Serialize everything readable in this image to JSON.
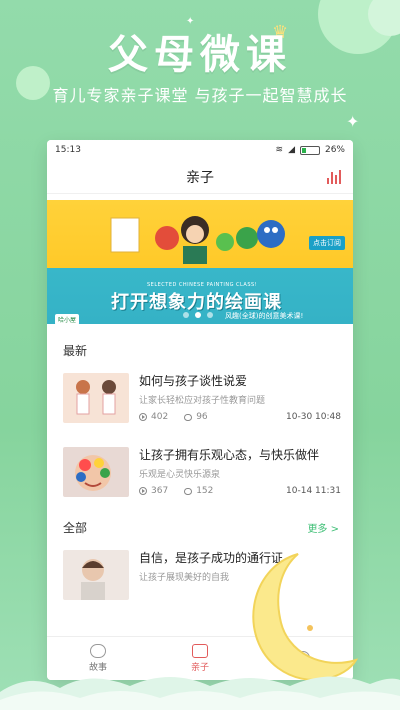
{
  "hero": {
    "title": "父母微课",
    "subtitle": "育儿专家亲子课堂  与孩子一起智慧成长"
  },
  "colors": {
    "background": "#8fd8a5",
    "accent_red": "#e25b5b",
    "accent_green": "#3fbf76",
    "banner_yellow": "#ffc928",
    "banner_teal": "#35b2c6"
  },
  "status_bar": {
    "time": "15:13",
    "battery": "26%",
    "battery_level": 0.26
  },
  "header": {
    "title": "亲子",
    "chart_icon": "bar-chart-icon"
  },
  "banner": {
    "tag": "点击订阅",
    "english": "SELECTED CHINESE PAINTING CLASS!",
    "headline": "打开想象力的绘画课",
    "caption": "风趣(全球)的创意美术课!",
    "logo": "哈小屋",
    "active_slide": 2,
    "slide_count": 3
  },
  "latest": {
    "title": "最新",
    "items": [
      {
        "title": "如何与孩子谈性说爱",
        "desc": "让家长轻松应对孩子性教育问题",
        "plays": "402",
        "comments": "96",
        "date": "10-30 10:48"
      },
      {
        "title": "让孩子拥有乐观心态，与快乐做伴",
        "desc": "乐观是心灵快乐源泉",
        "plays": "367",
        "comments": "152",
        "date": "10-14 11:31"
      }
    ]
  },
  "all": {
    "title": "全部",
    "more": "更多 >",
    "items": [
      {
        "title": "自信，是孩子成功的通行证",
        "desc": "让孩子展现美好的自我"
      }
    ]
  },
  "tabs": [
    {
      "label": "故事",
      "icon": "story-face-icon",
      "active": false
    },
    {
      "label": "亲子",
      "icon": "radio-icon",
      "active": true
    },
    {
      "label": "",
      "icon": "profile-face-icon",
      "active": false
    }
  ]
}
